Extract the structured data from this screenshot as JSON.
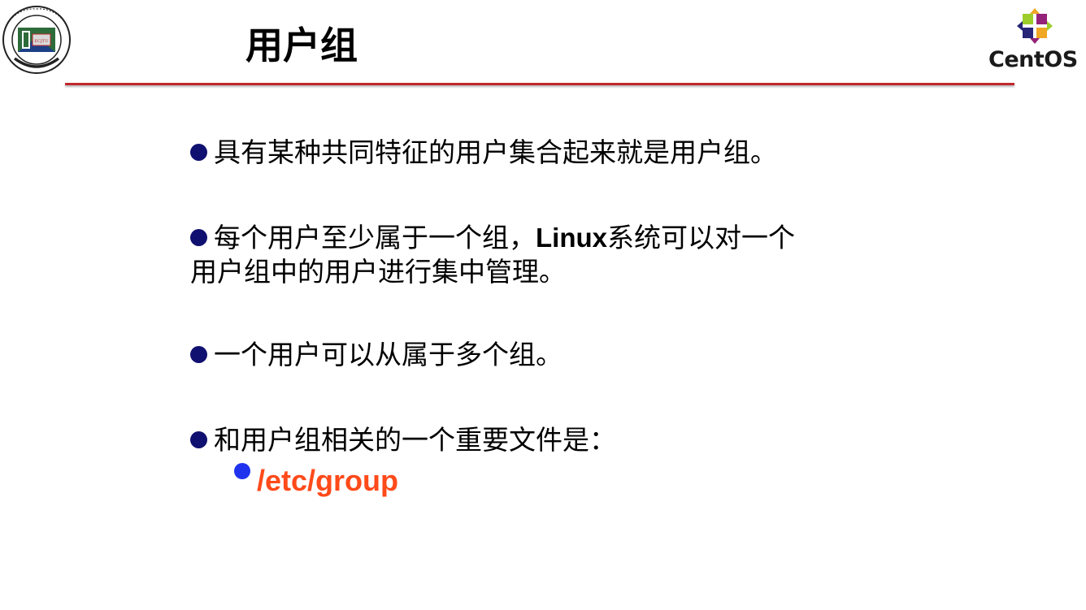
{
  "slide": {
    "title": "用户组",
    "logos": {
      "left": {
        "name": "East China Jiaotong University seal",
        "seal_ring_text": "EASTCHINAJIAOTONGUNIVERSITY",
        "seal_center_text": "华东交通大学",
        "seal_badge_text": "ECJTU"
      },
      "right": {
        "wordmark": "CentOS"
      }
    },
    "colors": {
      "rule": "#c0282d",
      "bullet_dot": "#101070",
      "sub_bullet_dot": "#1f33ee",
      "highlight_text": "#ff4a1a"
    },
    "bullets": [
      {
        "text": "具有某种共同特征的用户集合起来就是用户组。"
      },
      {
        "text_before_latin": "每个用户至少属于一个组，",
        "latin": "Linux",
        "text_after_latin": "系统可以对一个",
        "text_line2": "用户组中的用户进行集中管理。"
      },
      {
        "text": "一个用户可以从属于多个组。"
      },
      {
        "text": "和用户组相关的一个重要文件是：",
        "sub_items": [
          {
            "text": "/etc/group"
          }
        ]
      }
    ]
  }
}
